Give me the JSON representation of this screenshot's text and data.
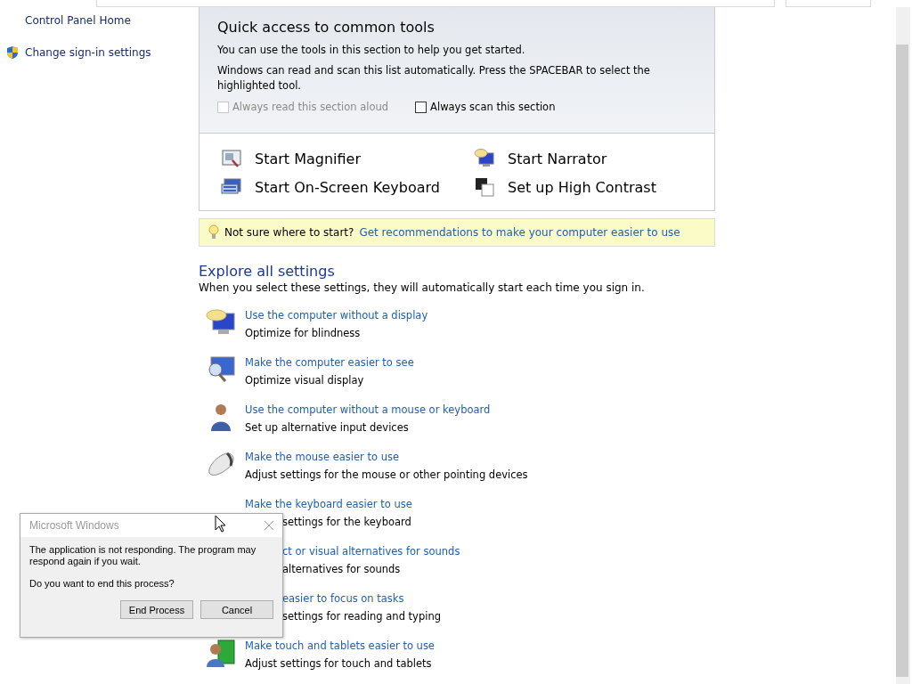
{
  "sidebar": {
    "items": [
      {
        "label": "Control Panel Home"
      },
      {
        "label": "Change sign-in settings"
      }
    ]
  },
  "quick_access": {
    "title": "Quick access to common tools",
    "paragraphs": [
      "You can use the tools in this section to help you get started.",
      "Windows can read and scan this list automatically.  Press the SPACEBAR to select the highlighted tool."
    ],
    "options": [
      {
        "label": "Always read this section aloud",
        "checked": false,
        "disabled": true
      },
      {
        "label": "Always scan this section",
        "checked": false,
        "disabled": false
      }
    ],
    "tools": [
      {
        "label": "Start Magnifier"
      },
      {
        "label": "Start Narrator"
      },
      {
        "label": "Start On-Screen Keyboard"
      },
      {
        "label": "Set up High Contrast"
      }
    ]
  },
  "tip": {
    "text": "Not sure where to start?",
    "link": "Get recommendations to make your computer easier to use"
  },
  "explore": {
    "title": "Explore all settings",
    "subtitle": "When you select these settings, they will automatically start each time you sign in.",
    "items": [
      {
        "kind": "full",
        "title": "Use the computer without a display",
        "description": "Optimize for blindness"
      },
      {
        "kind": "full",
        "title": "Make the computer easier to see",
        "description": "Optimize visual display"
      },
      {
        "kind": "full",
        "title": "Use the computer without a mouse or keyboard",
        "description": "Set up alternative input devices"
      },
      {
        "kind": "full",
        "title": "Make the mouse easier to use",
        "description": "Adjust settings for the mouse or other pointing devices"
      },
      {
        "kind": "description_covered",
        "title": "Make the keyboard easier to use",
        "description": "settings for the keyboard"
      },
      {
        "kind": "covered",
        "title": "ct or visual alternatives for sounds",
        "description": "alternatives for sounds"
      },
      {
        "kind": "covered",
        "title": "easier to focus on tasks",
        "description": "settings for reading and typing"
      },
      {
        "kind": "full",
        "title": "Make touch and tablets easier to use",
        "description": "Adjust settings for touch and tablets"
      }
    ]
  },
  "dialog": {
    "title": "Microsoft Windows",
    "message": "The application is not responding. The program may respond again if you wait.",
    "question": "Do you want to end this process?",
    "buttons": [
      "End Process",
      "Cancel"
    ]
  }
}
